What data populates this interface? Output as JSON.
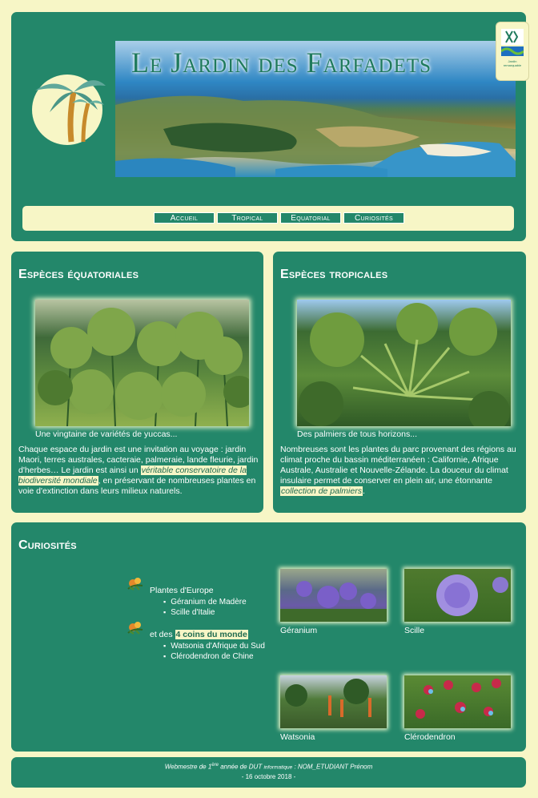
{
  "header": {
    "site_title": "Le Jardin des Farfadets",
    "badge_text": "Jardin remarquable",
    "nav": [
      {
        "label": "Accueil"
      },
      {
        "label": "Tropical"
      },
      {
        "label": "Equatorial"
      },
      {
        "label": "Curiosités"
      }
    ]
  },
  "equatorial": {
    "title": "Espèces équatoriales",
    "caption": "Une vingtaine de variétés de yuccas...",
    "text_before": "Chaque espace du jardin est une invitation au voyage : jardin Maori, terres australes, cacteraie, palmeraie, lande fleurie, jardin d'herbes… Le jardin est ainsi un ",
    "highlight": "véritable conservatoire de la biodiversité mondiale",
    "text_after": ", en préservant de nombreuses plantes en voie d'extinction dans leurs milieux naturels."
  },
  "tropical": {
    "title": "Espèces tropicales",
    "caption": "Des palmiers de tous horizons...",
    "text_before": "Nombreuses sont les plantes du parc provenant des régions au climat proche du bassin méditerranéen : Californie, Afrique Australe, Australie et Nouvelle-Zélande. La douceur du climat insulaire permet de conserver en plein air, une étonnante ",
    "highlight": "collection de palmiers",
    "text_after": "."
  },
  "curiosities": {
    "title": "Curiosités",
    "group1_label": "Plantes d'Europe",
    "group1_items": [
      "Géranium de Madère",
      "Scille d'Italie"
    ],
    "group2_prefix": "et des ",
    "group2_bold": "4 coins du monde",
    "group2_items": [
      "Watsonia d'Afrique du Sud",
      "Clérodendron de Chine"
    ],
    "thumbs": [
      {
        "caption": "Géranium"
      },
      {
        "caption": "Scille"
      },
      {
        "caption": "Watsonia"
      },
      {
        "caption": "Clérodendron"
      }
    ]
  },
  "footer": {
    "line1_a": "Webmestre de 1",
    "line1_sup": "ère",
    "line1_b": " année de DUT ",
    "line1_small": "informatique",
    "line1_c": " : NOM_ETUDIANT Prénom",
    "line2": "- 16 octobre 2018 -"
  },
  "colors": {
    "background": "#f7f6c6",
    "panel": "#23876a",
    "highlight_text": "#1f6b4f"
  }
}
